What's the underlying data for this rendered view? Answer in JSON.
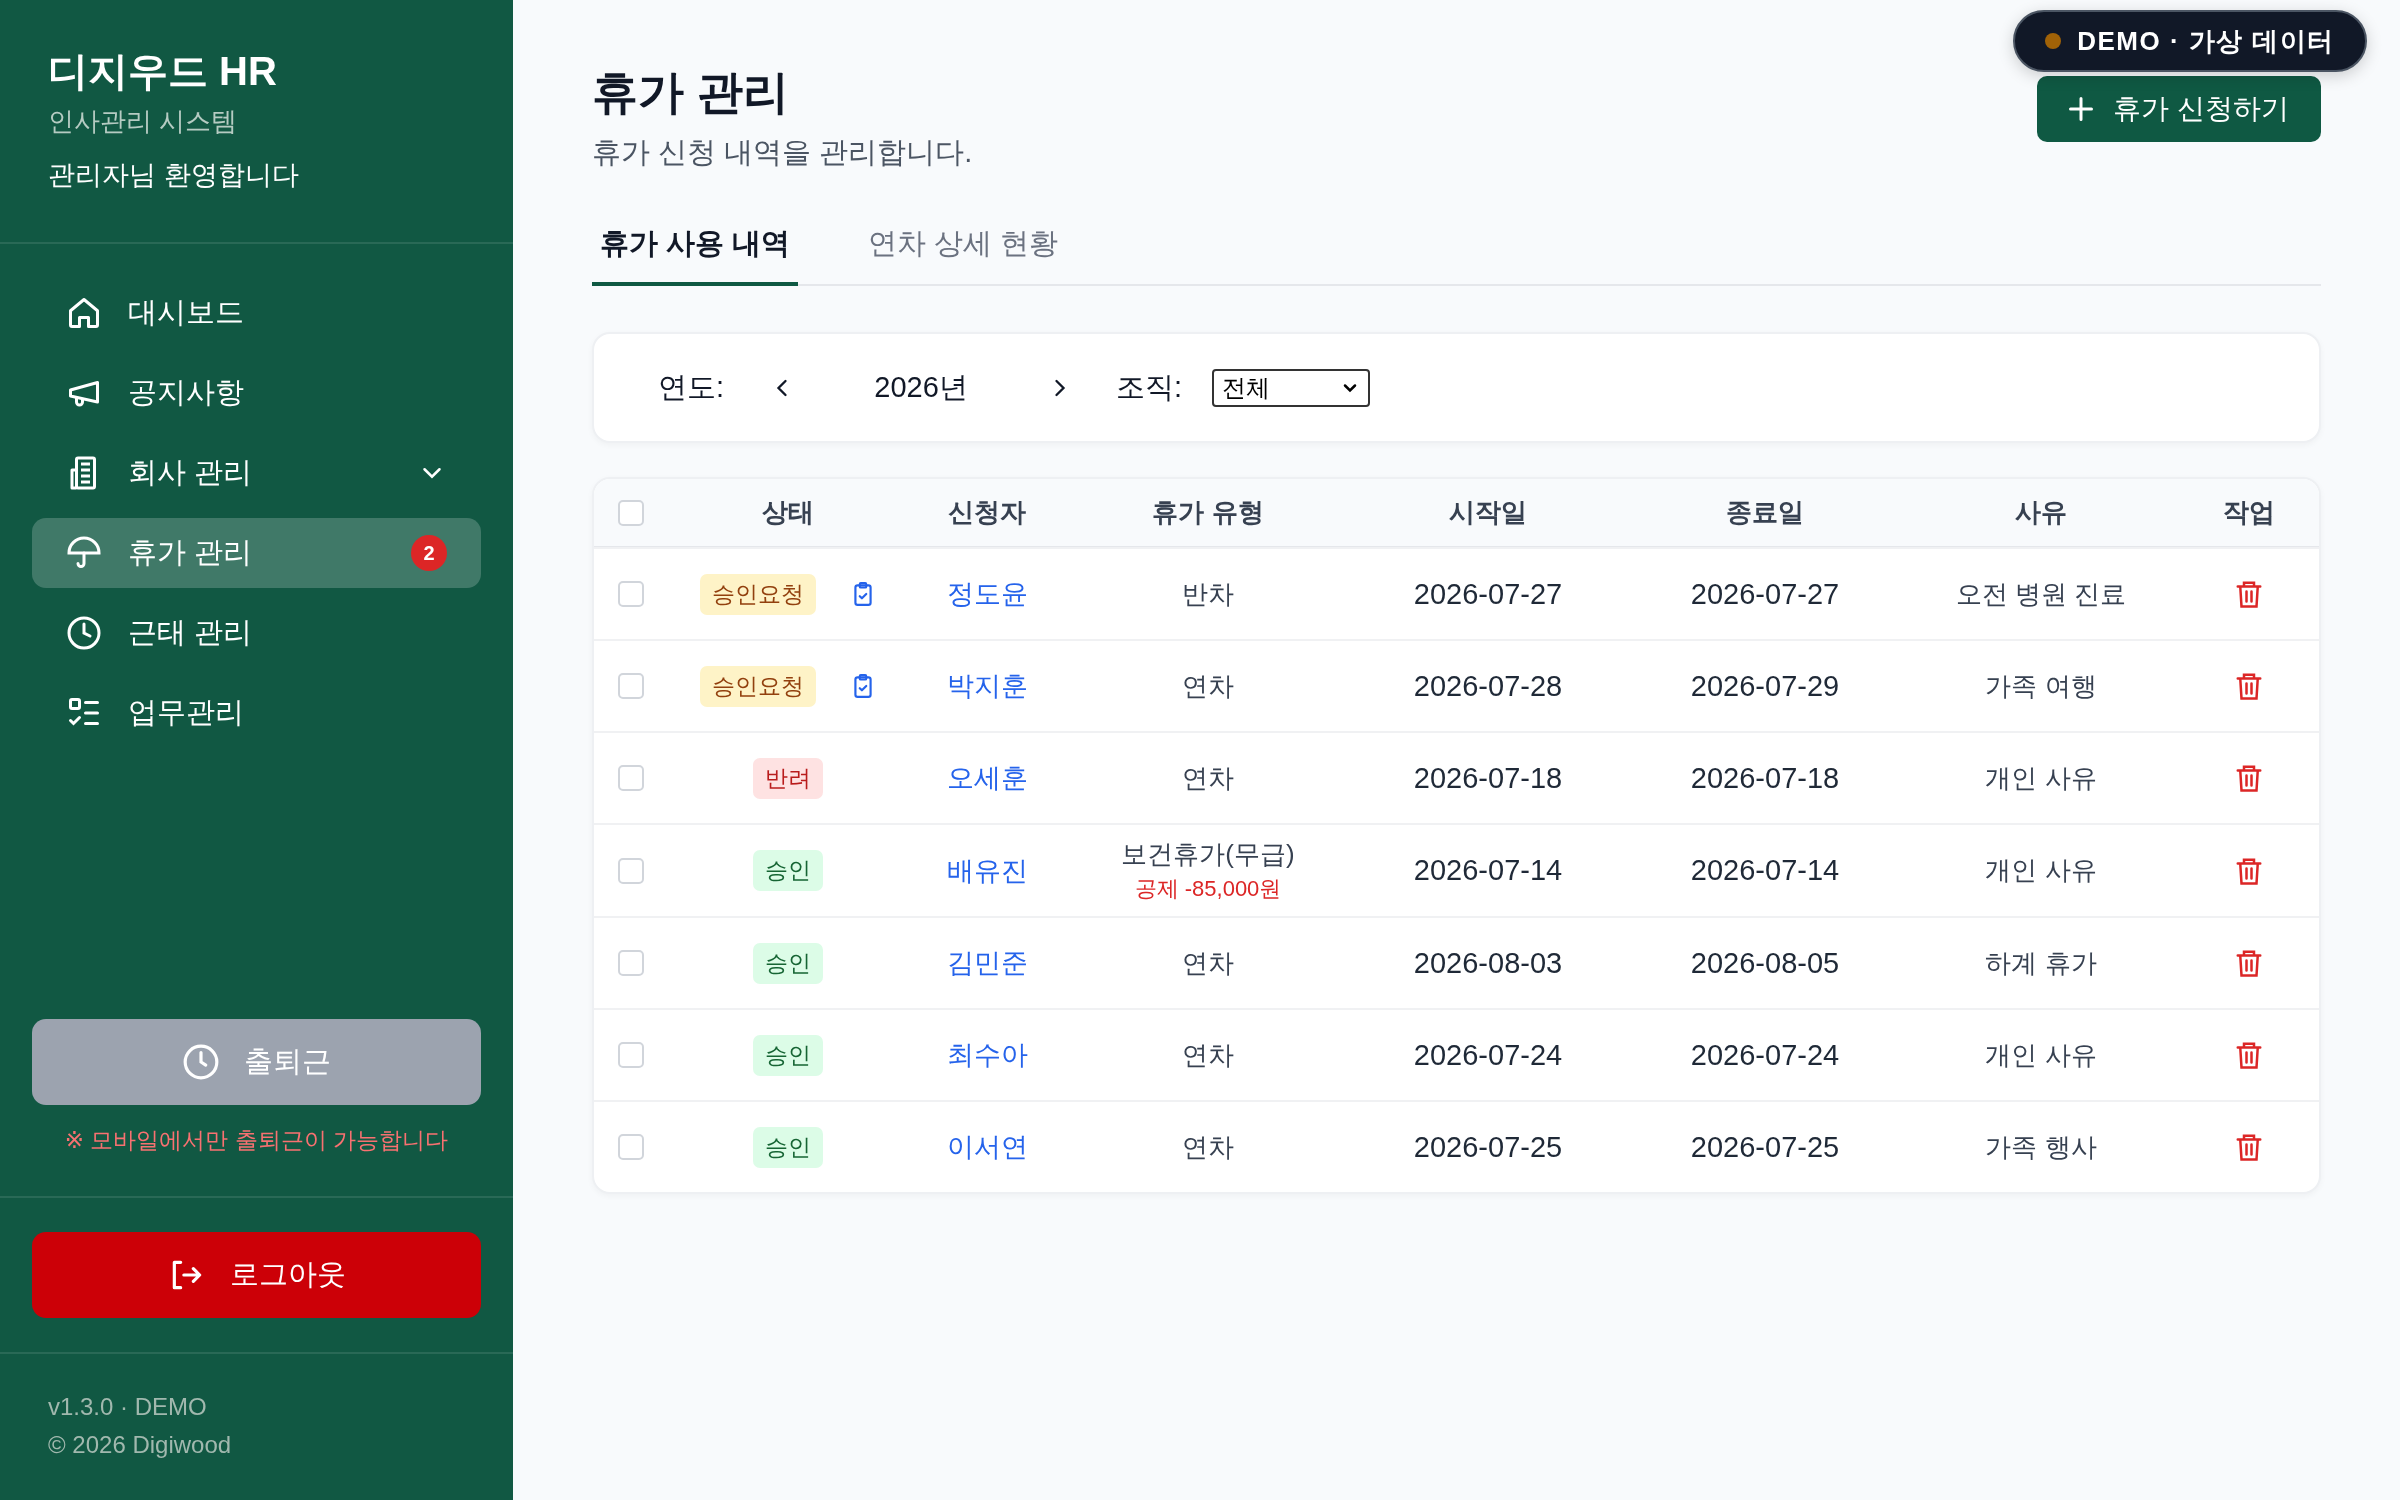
{
  "sidebar": {
    "brand": "디지우드 HR",
    "subtitle": "인사관리 시스템",
    "welcome": "관리자님 환영합니다",
    "nav": [
      {
        "label": "대시보드",
        "selected": false,
        "expandable": false
      },
      {
        "label": "공지사항",
        "selected": false,
        "expandable": false
      },
      {
        "label": "회사 관리",
        "selected": false,
        "expandable": true
      },
      {
        "label": "휴가 관리",
        "selected": true,
        "expandable": false,
        "badge": "2"
      },
      {
        "label": "근태 관리",
        "selected": false,
        "expandable": false
      },
      {
        "label": "업무관리",
        "selected": false,
        "expandable": false
      }
    ],
    "attendance_button": {
      "label": "출퇴근",
      "disabled": true
    },
    "attendance_note": "※ 모바일에서만 출퇴근이 가능합니다",
    "logout_button": "로그아웃",
    "footer": [
      "v1.3.0 · DEMO",
      "© 2026 Digiwood"
    ]
  },
  "page": {
    "title": "휴가 관리",
    "subtitle": "휴가 신청 내역을 관리합니다.",
    "new_button": "휴가 신청하기",
    "demo_badge": "DEMO · 가상 데이터"
  },
  "tabs": [
    {
      "label": "휴가 사용 내역",
      "selected": true
    },
    {
      "label": "연차 상세 현황",
      "selected": false
    }
  ],
  "filter": {
    "year_label": "연도:",
    "year": "2026년",
    "org_label": "조직:",
    "org_value": "전체"
  },
  "table": {
    "select_all_checked": false,
    "columns": [
      "상태",
      "신청자",
      "휴가 유형",
      "시작일",
      "종료일",
      "사유",
      "작업"
    ],
    "rows": [
      {
        "checked": false,
        "status": {
          "label": "승인요청",
          "kind": "pending"
        },
        "approve_icon": true,
        "name": "정도윤",
        "type": "반차",
        "start": "2026-07-27",
        "end": "2026-07-27",
        "reason": "오전 병원 진료"
      },
      {
        "checked": false,
        "status": {
          "label": "승인요청",
          "kind": "pending"
        },
        "approve_icon": true,
        "name": "박지훈",
        "type": "연차",
        "start": "2026-07-28",
        "end": "2026-07-29",
        "reason": "가족 여행"
      },
      {
        "checked": false,
        "status": {
          "label": "반려",
          "kind": "rejected"
        },
        "approve_icon": false,
        "name": "오세훈",
        "type": "연차",
        "start": "2026-07-18",
        "end": "2026-07-18",
        "reason": "개인 사유"
      },
      {
        "checked": false,
        "status": {
          "label": "승인",
          "kind": "approved"
        },
        "approve_icon": false,
        "name": "배유진",
        "type": "보건휴가(무급)",
        "deduction": "공제 -85,000원",
        "start": "2026-07-14",
        "end": "2026-07-14",
        "reason": "개인 사유"
      },
      {
        "checked": false,
        "status": {
          "label": "승인",
          "kind": "approved"
        },
        "approve_icon": false,
        "name": "김민준",
        "type": "연차",
        "start": "2026-08-03",
        "end": "2026-08-05",
        "reason": "하계 휴가"
      },
      {
        "checked": false,
        "status": {
          "label": "승인",
          "kind": "approved"
        },
        "approve_icon": false,
        "name": "최수아",
        "type": "연차",
        "start": "2026-07-24",
        "end": "2026-07-24",
        "reason": "개인 사유"
      },
      {
        "checked": false,
        "status": {
          "label": "승인",
          "kind": "approved"
        },
        "approve_icon": false,
        "name": "이서연",
        "type": "연차",
        "start": "2026-07-25",
        "end": "2026-07-25",
        "reason": "가족 행사"
      }
    ]
  }
}
